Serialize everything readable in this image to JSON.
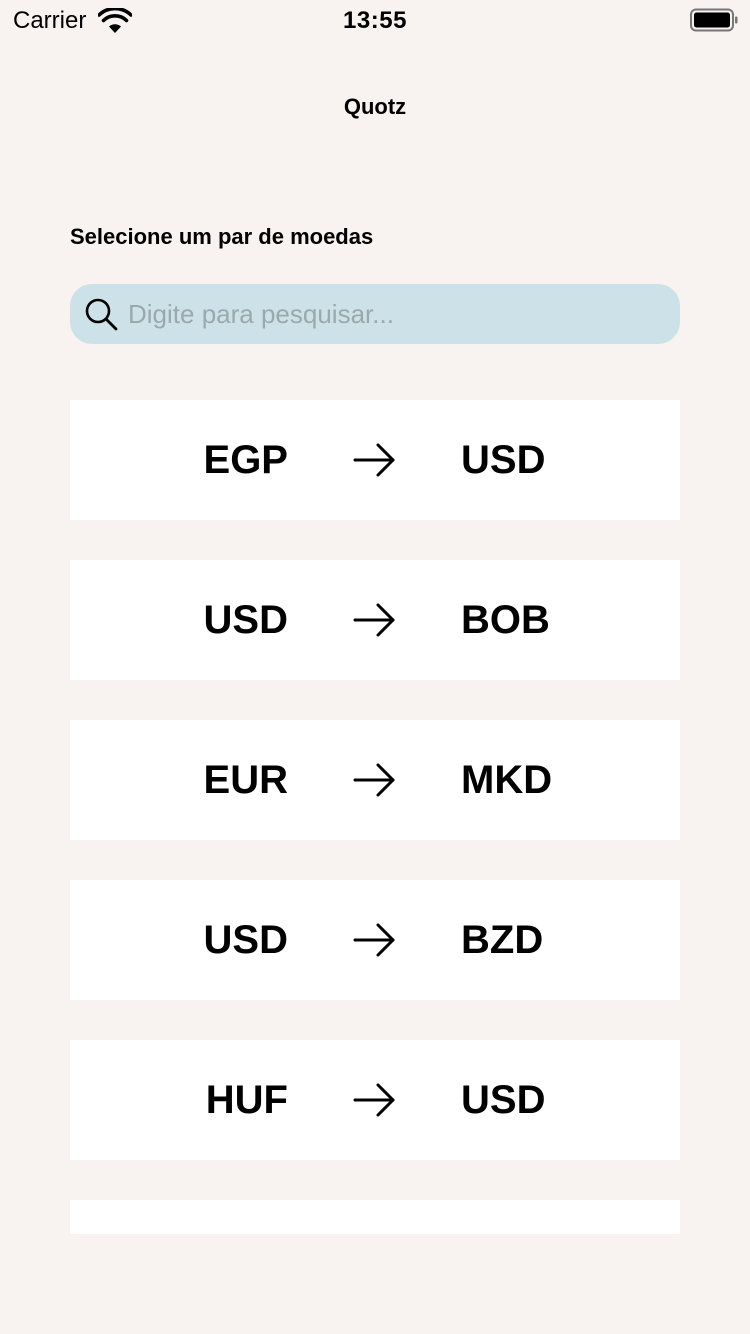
{
  "status_bar": {
    "carrier": "Carrier",
    "time": "13:55"
  },
  "header": {
    "title": "Quotz"
  },
  "main": {
    "section_label": "Selecione um par de moedas",
    "search": {
      "placeholder": "Digite para pesquisar...",
      "value": ""
    },
    "pairs": [
      {
        "from": "EGP",
        "to": "USD"
      },
      {
        "from": "USD",
        "to": "BOB"
      },
      {
        "from": "EUR",
        "to": "MKD"
      },
      {
        "from": "USD",
        "to": "BZD"
      },
      {
        "from": "HUF",
        "to": "USD"
      },
      {
        "from": "",
        "to": ""
      }
    ]
  },
  "colors": {
    "background": "#f8f2f1",
    "search_background": "#cde2e8",
    "card_background": "#ffffff",
    "placeholder": "#9aa9ae"
  },
  "icons": {
    "wifi": "wifi-icon",
    "battery": "battery-icon",
    "search": "search-icon",
    "arrow": "arrow-right-icon"
  }
}
